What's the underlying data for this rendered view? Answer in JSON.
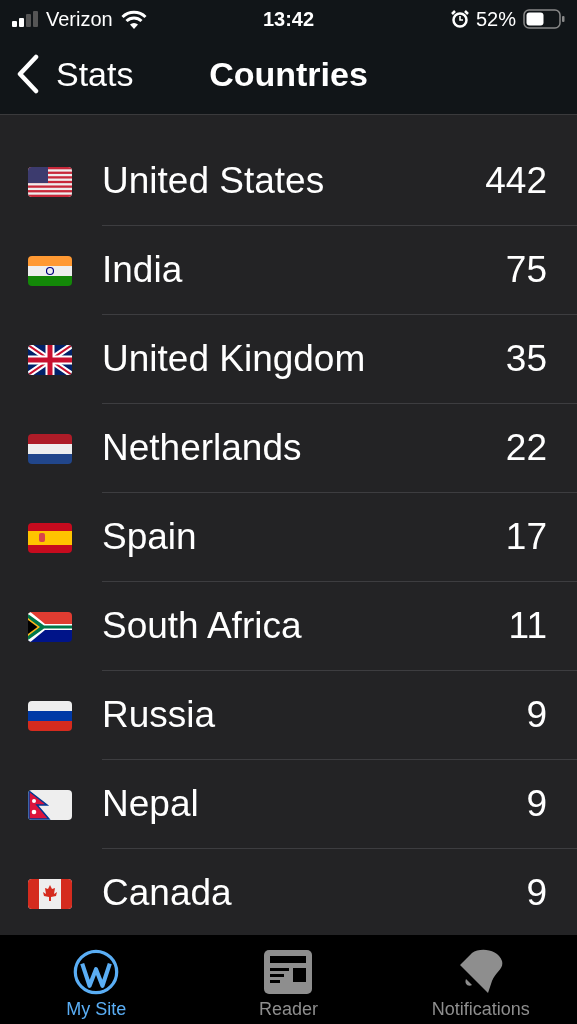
{
  "status_bar": {
    "carrier": "Verizon",
    "time": "13:42",
    "battery": "52%"
  },
  "nav_bar": {
    "back_label": "Stats",
    "title": "Countries"
  },
  "countries": [
    {
      "kind": "us",
      "name": "United States",
      "count": "442"
    },
    {
      "kind": "in",
      "name": "India",
      "count": "75"
    },
    {
      "kind": "gb",
      "name": "United Kingdom",
      "count": "35"
    },
    {
      "kind": "nl",
      "name": "Netherlands",
      "count": "22"
    },
    {
      "kind": "es",
      "name": "Spain",
      "count": "17"
    },
    {
      "kind": "za",
      "name": "South Africa",
      "count": "11"
    },
    {
      "kind": "ru",
      "name": "Russia",
      "count": "9"
    },
    {
      "kind": "np",
      "name": "Nepal",
      "count": "9"
    },
    {
      "kind": "ca",
      "name": "Canada",
      "count": "9"
    }
  ],
  "tab_bar": [
    {
      "kind": "site",
      "label": "My Site",
      "selected": true
    },
    {
      "kind": "reader",
      "label": "Reader",
      "selected": false
    },
    {
      "kind": "notifications",
      "label": "Notifications",
      "selected": false
    }
  ]
}
